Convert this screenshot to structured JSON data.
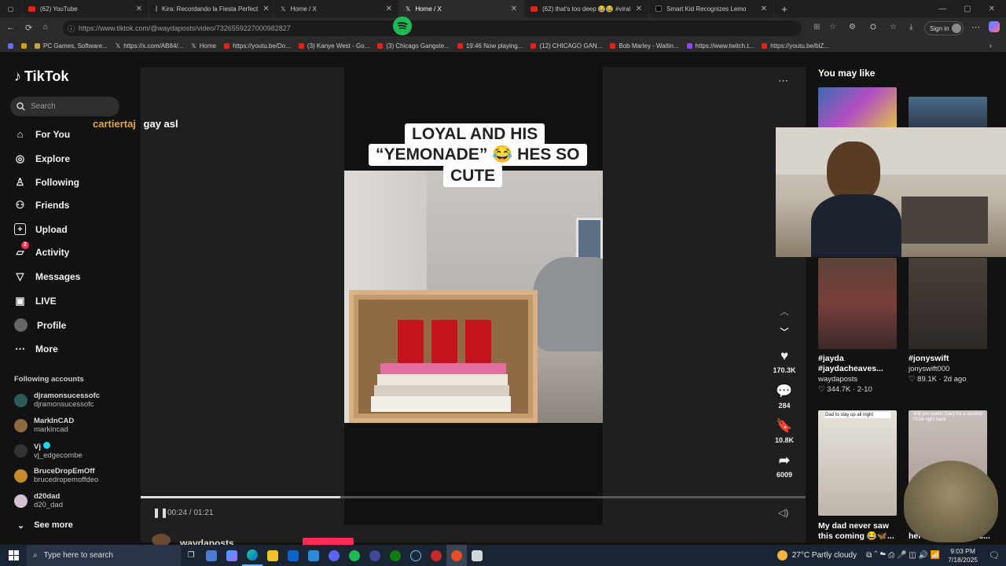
{
  "browser": {
    "tabs": [
      {
        "label": "(62) YouTube",
        "icon": "youtube-icon"
      },
      {
        "label": "Kira: Recordando la Fiesta Perfect",
        "icon": "tiktok-icon"
      },
      {
        "label": "Home / X",
        "icon": "x-icon"
      },
      {
        "label": "Home / X",
        "icon": "x-icon"
      },
      {
        "label": "(62) that's too deep 😂😂 #viral",
        "icon": "youtube-icon"
      },
      {
        "label": "Smart Kid Recognizes Lemo",
        "icon": "tiktok-icon"
      }
    ],
    "url": "https://www.tiktok.com/@waydaposts/video/7326559227000982827",
    "signin": "Sign in",
    "bookmarks": [
      "PC Games, Software...",
      "https://x.com/AB84/...",
      "Home",
      "https://youtu.be/Do...",
      "(3) Kanye West - Go...",
      "(3) Chicago Gangste...",
      "19:46 Now playing...",
      "(12) CHICAGO GAN...",
      "Bob Marley - Waitin...",
      "https://www.twitch.t...",
      "https://youtu.be/blZ..."
    ]
  },
  "tiktok": {
    "logo": "TikTok",
    "search_placeholder": "Search",
    "nav": [
      "For You",
      "Explore",
      "Following",
      "Friends",
      "Upload",
      "Activity",
      "Messages",
      "LIVE",
      "Profile",
      "More"
    ],
    "activity_badge": "2",
    "following_title": "Following accounts",
    "accounts": [
      {
        "name": "djramonsucessofc",
        "handle": "djramonsucessofc"
      },
      {
        "name": "MarkInCAD",
        "handle": "markincad"
      },
      {
        "name": "Vj",
        "handle": "vj_edgecombe"
      },
      {
        "name": "BruceDropEmOff",
        "handle": "brucedropemoffdeo"
      },
      {
        "name": "d20dad",
        "handle": "d20_dad"
      }
    ],
    "see_more": "See more"
  },
  "chat": {
    "user": "cartiertaj",
    "message": "gay asl"
  },
  "video": {
    "caption_lines": [
      "LOYAL AND HIS",
      "“YEMONADE” 😂 HES SO",
      "CUTE"
    ],
    "time": "00:24 / 01:21",
    "progress": 0.3,
    "author": "waydaposts",
    "likes": "170.3K",
    "comments": "284",
    "saves": "10.8K",
    "shares": "6009"
  },
  "recommendations": {
    "title": "You may like",
    "items": [
      {
        "title": "#jayda #jaydacheaves...",
        "author": "waydaposts",
        "likes": "344.7K",
        "date": "2-10"
      },
      {
        "title": "#jonyswift",
        "author": "jonyswift000",
        "likes": "89.1K",
        "date": "2d ago"
      },
      {
        "title": "My dad never saw this coming 😂🦋...",
        "author": "",
        "likes": "",
        "date": ""
      },
      {
        "title": "her new fit #fitchec...",
        "author": "",
        "likes": "",
        "date": ""
      }
    ],
    "thumb_text_1": "Dad to stay up all night",
    "thumb_text_2": "Will you watch Gary for a second I'll be right back"
  },
  "taskbar": {
    "search_placeholder": "Type here to search",
    "weather": "27°C  Partly cloudy",
    "time": "9:03 PM",
    "date": "7/18/2025"
  },
  "colors": {
    "tiktok_pink": "#fe2c55",
    "accent_blue": "#0078d4",
    "chat_name": "#e6a24b"
  }
}
